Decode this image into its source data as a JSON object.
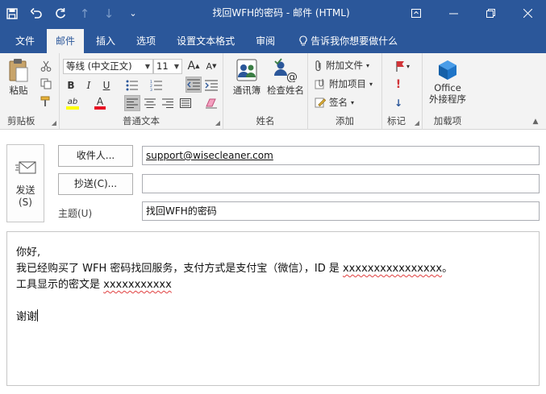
{
  "window": {
    "title": "找回WFH的密码  -  邮件 (HTML)",
    "controls": {
      "options": "⊡",
      "minimize": "—",
      "restore": "❐",
      "close": "✕"
    }
  },
  "qat": {
    "save": "💾",
    "undo": "↶",
    "redo": "↻",
    "up": "↑",
    "down": "↓",
    "more": "⌄"
  },
  "tabs": [
    {
      "label": "文件"
    },
    {
      "label": "邮件"
    },
    {
      "label": "插入"
    },
    {
      "label": "选项"
    },
    {
      "label": "设置文本格式"
    },
    {
      "label": "审阅"
    },
    {
      "label": "告诉我你想要做什么"
    }
  ],
  "ribbon": {
    "clipboard": {
      "label": "剪贴板",
      "paste": "粘贴"
    },
    "basic_text": {
      "label": "普通文本",
      "font": "等线 (中文正文)",
      "size": "11",
      "grow": "A",
      "shrink": "A",
      "bold": "B",
      "italic": "I",
      "underline": "U",
      "highlight": "ab",
      "font_color": "A"
    },
    "names": {
      "label": "姓名",
      "address_book": "通讯簿",
      "check_names": "检查姓名"
    },
    "include": {
      "label": "添加",
      "attach_file": "附加文件",
      "attach_item": "附加项目",
      "signature": "签名"
    },
    "tags": {
      "label": "标记"
    },
    "addins": {
      "label": "加载项",
      "office_line1": "Office",
      "office_line2": "外接程序"
    }
  },
  "compose": {
    "send_label": "发送",
    "send_shortcut": "(S)",
    "to_button": "收件人...",
    "cc_button": "抄送(C)...",
    "to_value": "support@wisecleaner.com",
    "cc_value": "",
    "subject_label": "主题(U)",
    "subject_value": "找回WFH的密码",
    "body": {
      "line1": "你好,",
      "line2_pre": "我已经购买了 WFH 密码找回服务，支付方式是支付宝（微信），ID 是 ",
      "line2_id": "xxxxxxxxxxxxxxxx",
      "line2_post": "。",
      "line3_pre": "工具显示的密文是 ",
      "line3_cipher": "xxxxxxxxxxx",
      "line4": "谢谢"
    }
  },
  "colors": {
    "accent": "#2b579a",
    "ribbon_bg": "#f3f3f3",
    "highlight": "#ffff00",
    "font_red": "#e81123",
    "flag_red": "#d13438"
  }
}
